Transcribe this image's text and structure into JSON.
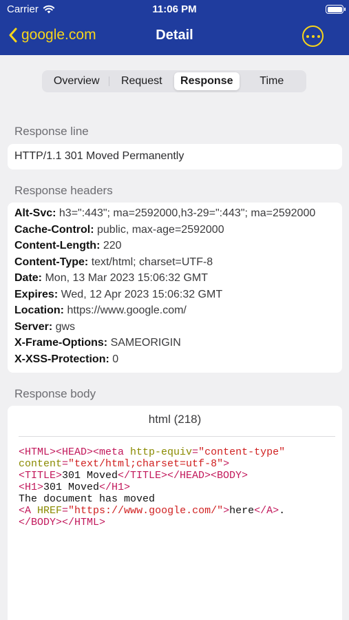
{
  "status_bar": {
    "carrier": "Carrier",
    "time": "11:06 PM"
  },
  "nav": {
    "back_label": "google.com",
    "title": "Detail"
  },
  "tabs": [
    {
      "label": "Overview"
    },
    {
      "label": "Request"
    },
    {
      "label": "Response",
      "active": true
    },
    {
      "label": "Time"
    }
  ],
  "response_line": {
    "label": "Response line",
    "value": "HTTP/1.1 301 Moved Permanently"
  },
  "response_headers": {
    "label": "Response headers",
    "items": [
      {
        "key": "Alt-Svc:",
        "value": "h3=\":443\"; ma=2592000,h3-29=\":443\"; ma=2592000"
      },
      {
        "key": "Cache-Control:",
        "value": "public, max-age=2592000"
      },
      {
        "key": "Content-Length:",
        "value": "220"
      },
      {
        "key": "Content-Type:",
        "value": "text/html; charset=UTF-8"
      },
      {
        "key": "Date:",
        "value": "Mon, 13 Mar 2023 15:06:32 GMT"
      },
      {
        "key": "Expires:",
        "value": "Wed, 12 Apr 2023 15:06:32 GMT"
      },
      {
        "key": "Location:",
        "value": "https://www.google.com/"
      },
      {
        "key": "Server:",
        "value": "gws"
      },
      {
        "key": "X-Frame-Options:",
        "value": "SAMEORIGIN"
      },
      {
        "key": "X-XSS-Protection:",
        "value": "0"
      }
    ]
  },
  "response_body": {
    "label": "Response body",
    "format": "html (218)",
    "code_lines": [
      [
        [
          "tag",
          "<HTML><HEAD><meta "
        ],
        [
          "attr",
          "http-equiv"
        ],
        [
          "tag",
          "="
        ],
        [
          "str",
          "\"content-type\""
        ]
      ],
      [
        [
          "attr",
          "content"
        ],
        [
          "tag",
          "="
        ],
        [
          "str",
          "\"text/html;charset=utf-8\""
        ],
        [
          "tag",
          ">"
        ]
      ],
      [
        [
          "tag",
          "<TITLE>"
        ],
        [
          "txt",
          "301 Moved"
        ],
        [
          "tag",
          "</TITLE></HEAD><BODY>"
        ]
      ],
      [
        [
          "tag",
          "<H1>"
        ],
        [
          "txt",
          "301 Moved"
        ],
        [
          "tag",
          "</H1>"
        ]
      ],
      [
        [
          "txt",
          "The document has moved"
        ]
      ],
      [
        [
          "tag",
          "<A "
        ],
        [
          "attr",
          "HREF"
        ],
        [
          "tag",
          "="
        ],
        [
          "str",
          "\"https://www.google.com/\""
        ],
        [
          "tag",
          ">"
        ],
        [
          "txt",
          "here"
        ],
        [
          "tag",
          "</A>"
        ],
        [
          "txt",
          "."
        ]
      ],
      [
        [
          "tag",
          "</BODY></HTML>"
        ]
      ]
    ]
  },
  "colors": {
    "nav_bar": "#1f3c9e",
    "accent_yellow": "#f7d51b",
    "code_tag": "#c2185b",
    "code_attr": "#8a8a00",
    "code_string": "#d02020"
  },
  "icons": {
    "back": "chevron-left-icon",
    "more": "more-ellipsis-icon",
    "wifi": "wifi-icon",
    "battery": "battery-icon"
  }
}
